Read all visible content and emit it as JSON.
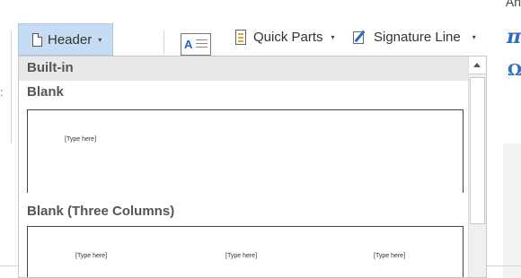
{
  "window": {
    "corner_text": "An"
  },
  "ribbon": {
    "header_label": "Header",
    "quick_parts_label": "Quick Parts",
    "signature_line_label": "Signature Line",
    "equation_symbol": "π",
    "symbol_symbol": "Ω",
    "text_box_glyph": "A"
  },
  "dropdown": {
    "section": "Built-in",
    "items": [
      {
        "title": "Blank",
        "placeholders": [
          "[Type here]"
        ]
      },
      {
        "title": "Blank (Three Columns)",
        "placeholders": [
          "[Type here]",
          "[Type here]",
          "[Type here]"
        ]
      }
    ]
  }
}
